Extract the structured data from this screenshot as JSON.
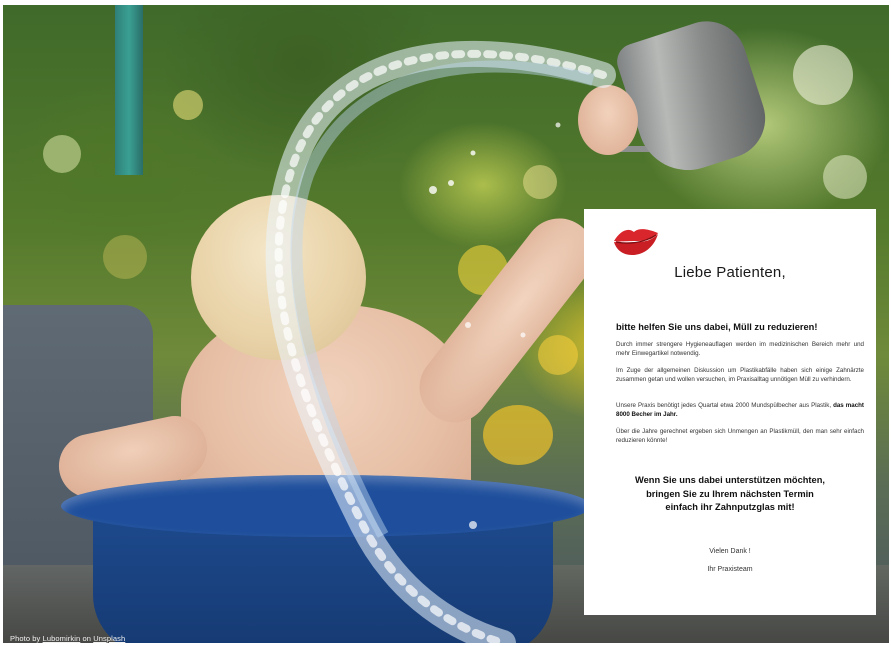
{
  "photo": {
    "credit_prefix": "Photo by ",
    "credit_author": "Lubomirkin",
    "credit_mid": " on ",
    "credit_source": "Unsplash"
  },
  "flyer": {
    "title": "Liebe Patienten,",
    "heading": "bitte helfen Sie uns dabei, Müll zu reduzieren!",
    "paragraphs": {
      "p1": "Durch immer strengere Hygieneauflagen werden im medizinischen Bereich mehr und mehr Einwegartikel notwendig.",
      "p2": "Im Zuge der allgemeinen Diskussion um Plastikabfälle haben sich einige Zahnärzte zusammen getan und wollen versuchen, im Praxisalltag unnötigen Müll zu verhindern.",
      "p3_start": "Unsere Praxis benötigt jedes Quartal etwa 2000 Mundspülbecher aus Plastik, ",
      "p3_bold": "das macht 8000 Becher im Jahr.",
      "p4": "Über die Jahre gerechnet ergeben sich Unmengen an Plastikmüll, den man sehr einfach reduzieren könnte!"
    },
    "cta_line1": "Wenn Sie uns dabei unterstützen möchten,",
    "cta_line2": "bringen Sie zu Ihrem nächsten Termin",
    "cta_line3": "einfach ihr Zahnputzglas mit!",
    "thanks": "Vielen Dank !",
    "signoff": "Ihr Praxisteam",
    "lips_icon": "lips-icon",
    "accent_color": "#d9262c"
  }
}
